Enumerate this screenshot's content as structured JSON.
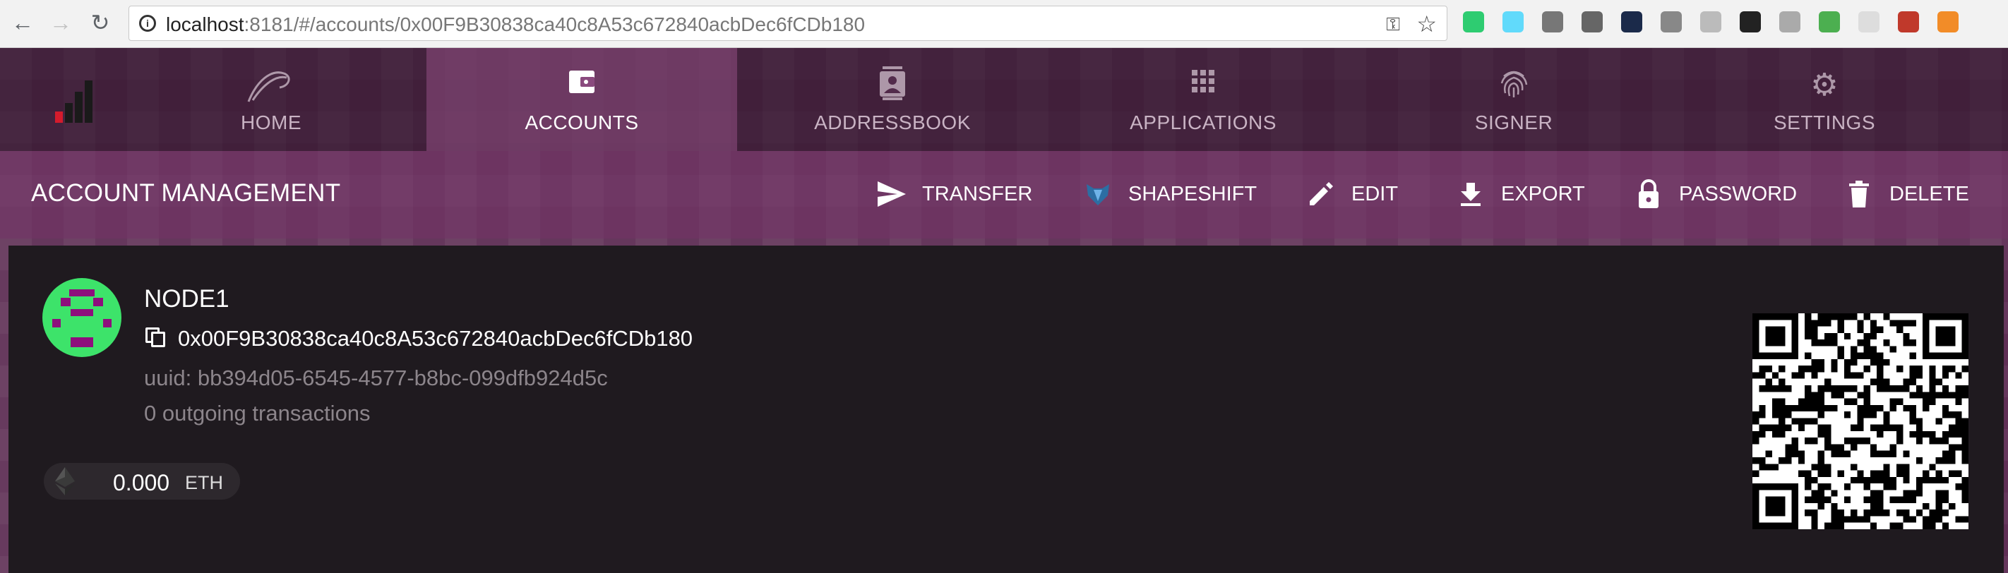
{
  "browser": {
    "url_host": "localhost",
    "url_rest": ":8181/#/accounts/0x00F9B30838ca40c8A53c672840acbDec6fCDb180",
    "extensions": [
      "ext-1-icon",
      "react-devtools-icon",
      "ext-3-icon",
      "ext-4-icon",
      "ext-5-icon",
      "ext-6-icon",
      "ext-7-icon",
      "panda-icon",
      "ext-9-icon",
      "wechat-icon",
      "shield-icon",
      "ext-12-icon",
      "metamask-icon"
    ]
  },
  "nav": {
    "tabs": [
      {
        "label": "HOME",
        "icon": "parity-logo-icon"
      },
      {
        "label": "ACCOUNTS",
        "icon": "wallet-icon"
      },
      {
        "label": "ADDRESSBOOK",
        "icon": "contact-card-icon"
      },
      {
        "label": "APPLICATIONS",
        "icon": "apps-grid-icon"
      },
      {
        "label": "SIGNER",
        "icon": "fingerprint-icon"
      },
      {
        "label": "SETTINGS",
        "icon": "gear-icon"
      }
    ],
    "active": "ACCOUNTS"
  },
  "actionbar": {
    "title": "ACCOUNT MANAGEMENT",
    "actions": [
      {
        "label": "TRANSFER",
        "icon": "send-icon"
      },
      {
        "label": "SHAPESHIFT",
        "icon": "shapeshift-fox-icon"
      },
      {
        "label": "EDIT",
        "icon": "pencil-icon"
      },
      {
        "label": "EXPORT",
        "icon": "download-icon"
      },
      {
        "label": "PASSWORD",
        "icon": "lock-icon"
      },
      {
        "label": "DELETE",
        "icon": "trash-icon"
      }
    ]
  },
  "account": {
    "name": "NODE1",
    "address": "0x00F9B30838ca40c8A53c672840acbDec6fCDb180",
    "uuid": "uuid: bb394d05-6545-4577-b8bc-099dfb924d5c",
    "tx_count": "0 outgoing transactions",
    "balance": {
      "value": "0.000",
      "unit": "ETH"
    }
  },
  "colors": {
    "accent_purple": "#6b3560",
    "card_bg": "#1f1a1f",
    "avatar_green": "#3de36a",
    "avatar_purple": "#8e0f7c"
  }
}
